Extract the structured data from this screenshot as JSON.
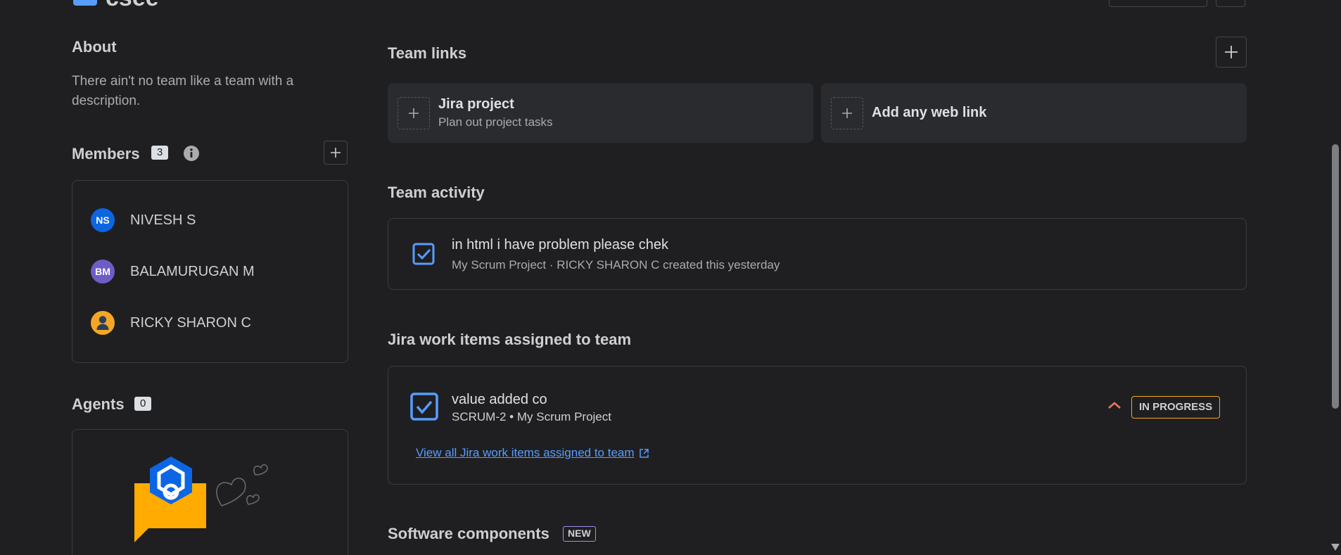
{
  "header": {
    "title": "csee"
  },
  "about": {
    "heading": "About",
    "description": "There ain't no team like a team with a description."
  },
  "members": {
    "heading": "Members",
    "count": "3",
    "list": [
      {
        "initials": "NS",
        "name": "NIVESH S",
        "color": "#0c66e4"
      },
      {
        "initials": "BM",
        "name": "BALAMURUGAN M",
        "color": "#6e5dc6"
      },
      {
        "initials": "",
        "name": "RICKY SHARON C",
        "color": "#f5a623"
      }
    ]
  },
  "agents": {
    "heading": "Agents",
    "count": "0"
  },
  "team_links": {
    "heading": "Team links",
    "cards": [
      {
        "title": "Jira project",
        "subtitle": "Plan out project tasks"
      },
      {
        "title": "Add any web link",
        "subtitle": ""
      }
    ]
  },
  "team_activity": {
    "heading": "Team activity",
    "item": {
      "title": "in html i have problem please chek",
      "meta": "My Scrum Project · RICKY SHARON C created this yesterday"
    }
  },
  "work_items": {
    "heading": "Jira work items assigned to team",
    "item": {
      "title": "value added co",
      "meta": "SCRUM-2 • My Scrum Project",
      "status": "IN PROGRESS"
    },
    "view_all": "View all Jira work items assigned to team"
  },
  "software_components": {
    "heading": "Software components",
    "badge": "NEW"
  },
  "colors": {
    "background": "#1f1f21",
    "accent": "#579dff",
    "status_border": "#f5a623",
    "priority": "#f87462"
  }
}
